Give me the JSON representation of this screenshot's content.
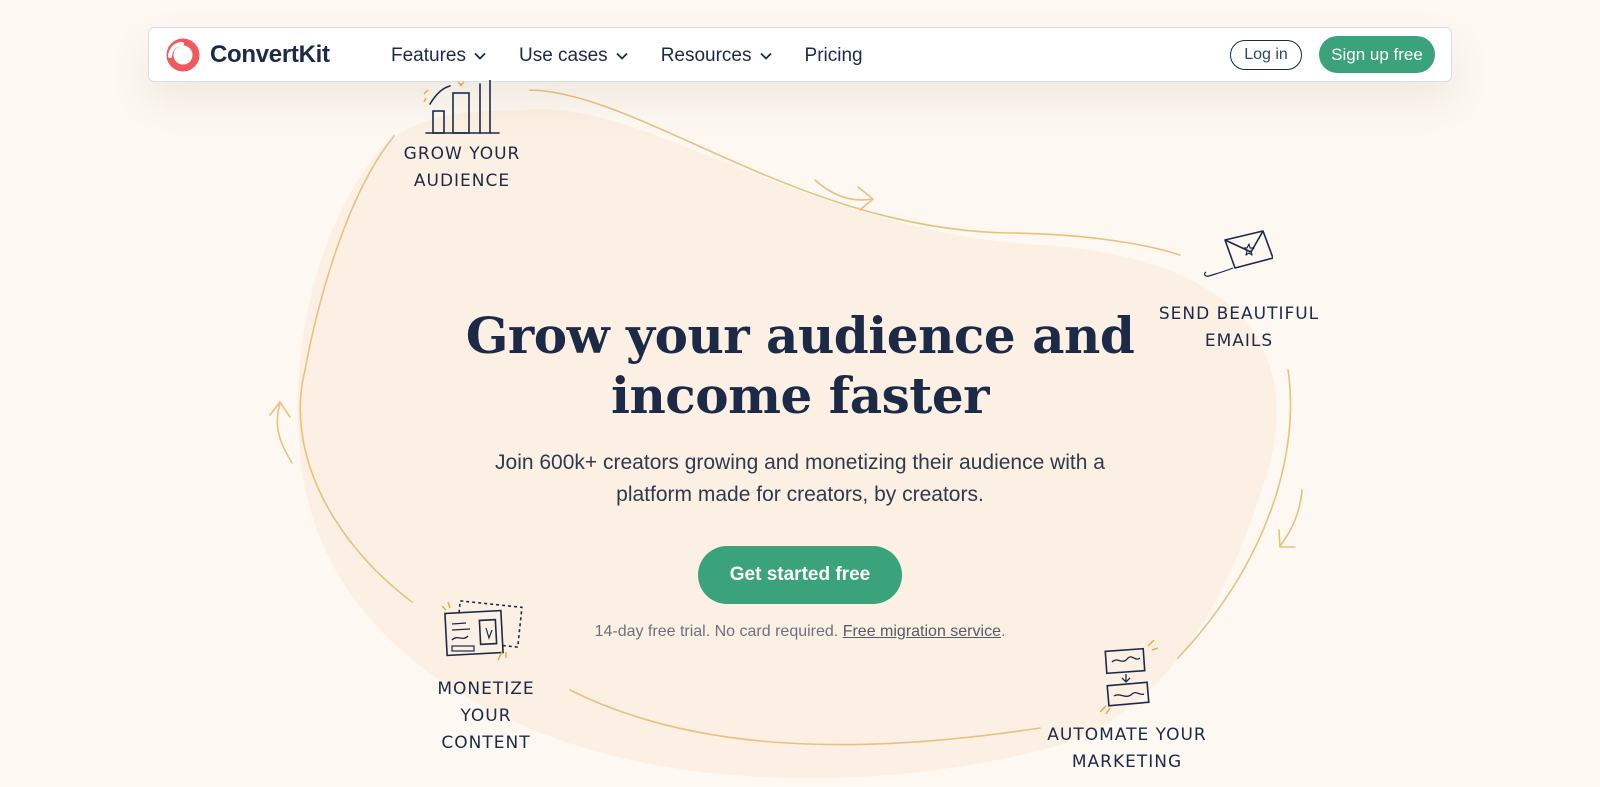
{
  "nav": {
    "brand": "ConvertKit",
    "items": [
      {
        "label": "Features",
        "has_dropdown": true
      },
      {
        "label": "Use cases",
        "has_dropdown": true
      },
      {
        "label": "Resources",
        "has_dropdown": true
      },
      {
        "label": "Pricing",
        "has_dropdown": false
      }
    ],
    "login_label": "Log in",
    "signup_label": "Sign up free"
  },
  "hero": {
    "title_line1": "Grow your audience and",
    "title_line2": "income faster",
    "subtitle": "Join 600k+ creators growing and monetizing their audience with a platform made for creators, by creators.",
    "cta_label": "Get started free",
    "note_text": "14-day free trial. No card required. ",
    "note_link": "Free migration service",
    "note_end": "."
  },
  "steps": {
    "grow_line1": "GROW YOUR",
    "grow_line2": "AUDIENCE",
    "send_line1": "SEND BEAUTIFUL",
    "send_line2": "EMAILS",
    "automate_line1": "AUTOMATE YOUR",
    "automate_line2": "MARKETING",
    "monetize_line1": "MONETIZE YOUR",
    "monetize_line2": "CONTENT"
  },
  "icons": {
    "logo": "convertkit-logo-icon",
    "grow": "bar-chart-icon",
    "send": "envelope-icon",
    "automate": "workflow-icon",
    "monetize": "product-card-icon"
  },
  "colors": {
    "background": "#fdf8f2",
    "blob": "#fbf0e3",
    "accent_green": "#3aa37c",
    "brand_red": "#ef5a5e",
    "navy": "#1c2a47",
    "sketch_orange": "#e9c17f"
  }
}
